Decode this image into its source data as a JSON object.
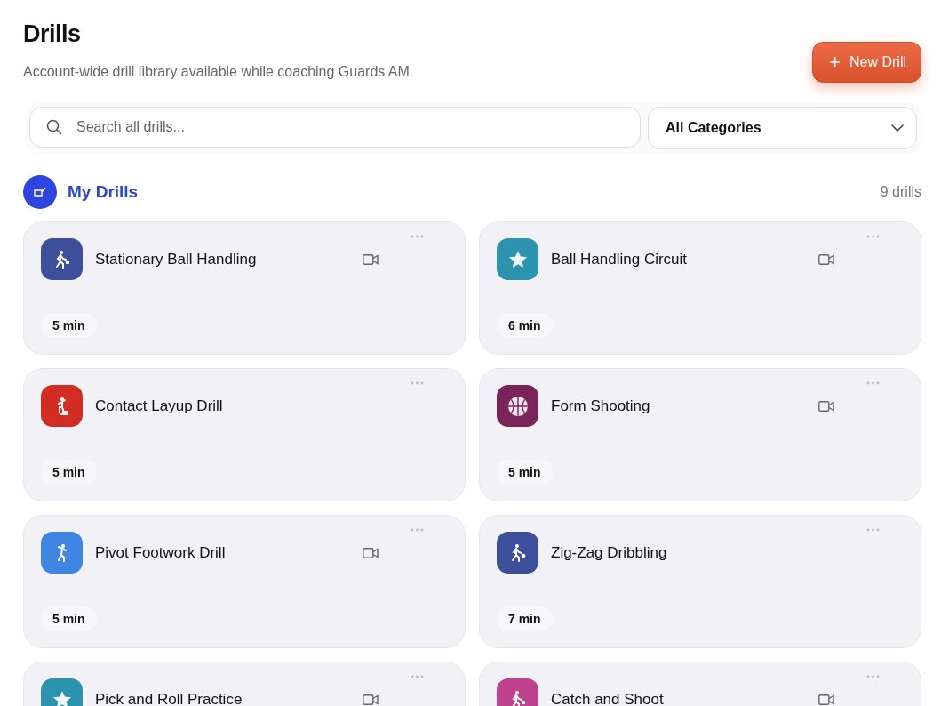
{
  "header": {
    "title": "Drills",
    "subtitle": "Account-wide drill library available while coaching Guards AM.",
    "new_button": {
      "icon": "+",
      "label": "New Drill"
    }
  },
  "filters": {
    "search": {
      "placeholder": "Search all drills..."
    },
    "category": {
      "value": "All Categories"
    }
  },
  "section": {
    "title": "My Drills",
    "count": "9 drills"
  },
  "drills": [
    {
      "title": "Stationary Ball Handling",
      "duration": "5 min",
      "color": "#3d4f9a",
      "kind": "dribble",
      "video": true
    },
    {
      "title": "Ball Handling Circuit",
      "duration": "6 min",
      "color": "#2b93ad",
      "kind": "star",
      "video": true
    },
    {
      "title": "Contact Layup Drill",
      "duration": "5 min",
      "color": "#d12d22",
      "kind": "layup",
      "video": false
    },
    {
      "title": "Form Shooting",
      "duration": "5 min",
      "color": "#7a2459",
      "kind": "basketball",
      "video": true
    },
    {
      "title": "Pivot Footwork Drill",
      "duration": "5 min",
      "color": "#3f85e2",
      "kind": "pivot",
      "video": true
    },
    {
      "title": "Zig-Zag Dribbling",
      "duration": "7 min",
      "color": "#3d4f9a",
      "kind": "dribble",
      "video": false
    },
    {
      "title": "Pick and Roll Practice",
      "color": "#2b93ad",
      "kind": "star",
      "video": true
    },
    {
      "title": "Catch and Shoot",
      "color": "#c0428f",
      "kind": "dribble",
      "video": true
    }
  ]
}
